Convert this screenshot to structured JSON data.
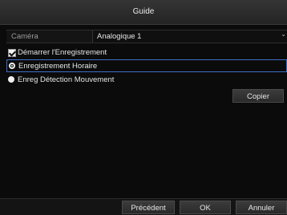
{
  "window": {
    "title": "Guide"
  },
  "camera": {
    "label": "Caméra",
    "value": "Analogique 1"
  },
  "options": {
    "start_recording": {
      "label": "Démarrer l'Enregistrement",
      "checked": true
    },
    "schedule_recording": {
      "label": "Enregistrement Horaire",
      "selected": true
    },
    "motion_recording": {
      "label": "Enreg Détection Mouvement",
      "selected": false
    }
  },
  "buttons": {
    "copy": "Copier",
    "previous": "Précédent",
    "ok": "OK",
    "cancel": "Annuler"
  },
  "colors": {
    "highlight": "#3e6fc5",
    "background": "#0b0b0b"
  }
}
